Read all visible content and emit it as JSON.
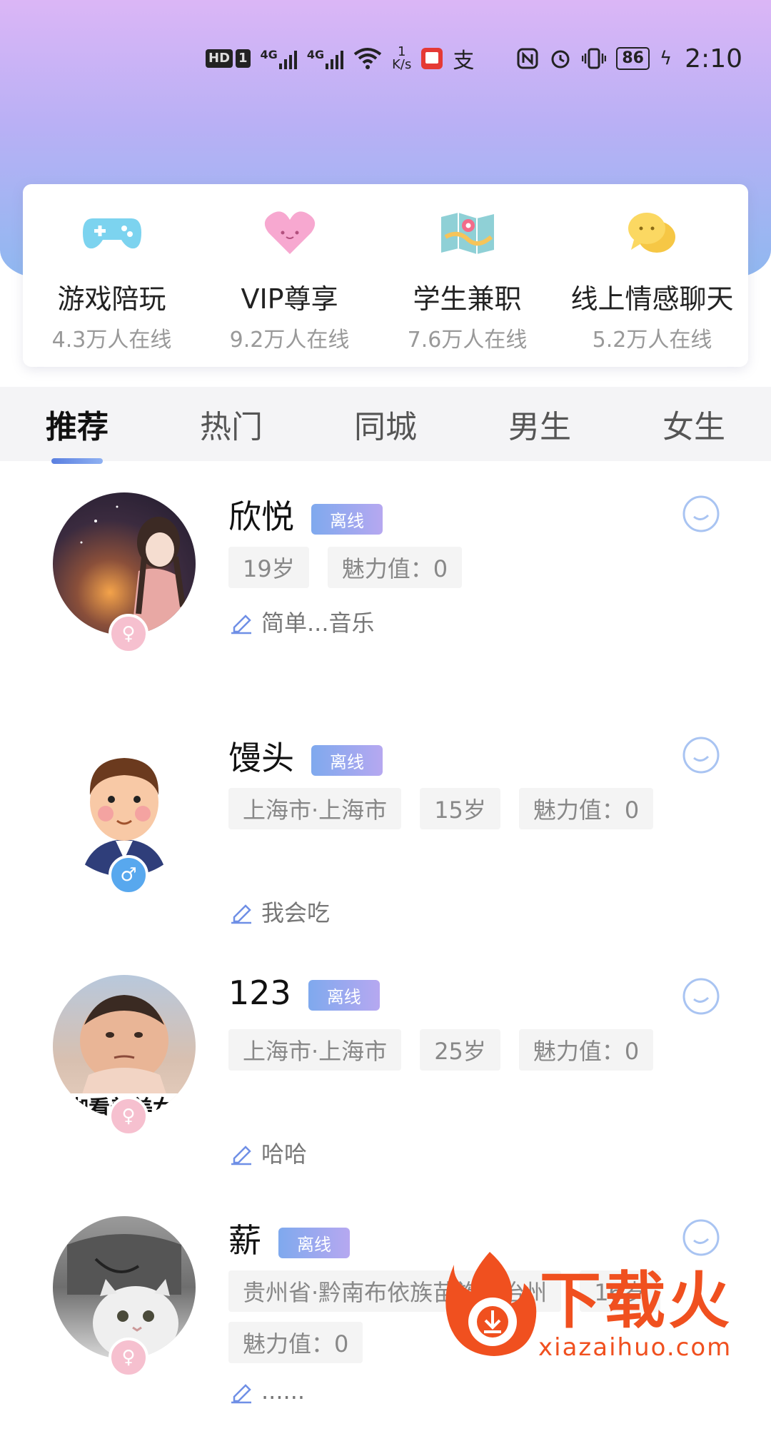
{
  "status_bar": {
    "hd": "HD",
    "sim": "1",
    "net1": "4G",
    "net2": "4G",
    "speed_value": "1",
    "speed_unit": "K/s",
    "alipay": "支",
    "battery": "86",
    "time": "2:10"
  },
  "categories": [
    {
      "title": "游戏陪玩",
      "online": "4.3万人在线",
      "icon": "gamepad-icon"
    },
    {
      "title": "VIP尊享",
      "online": "9.2万人在线",
      "icon": "heart-icon"
    },
    {
      "title": "学生兼职",
      "online": "7.6万人在线",
      "icon": "map-icon"
    },
    {
      "title": "线上情感聊天",
      "online": "5.2万人在线",
      "icon": "chat-bubbles-icon"
    }
  ],
  "tabs": [
    "推荐",
    "热门",
    "同城",
    "男生",
    "女生"
  ],
  "users": [
    {
      "name": "欣悦",
      "status": "离线",
      "tags": [
        "19岁",
        "魅力值：0"
      ],
      "signature": "简单...音乐",
      "gender": "female"
    },
    {
      "name": "馒头",
      "status": "离线",
      "tags": [
        "上海市·上海市",
        "15岁",
        "魅力值：0"
      ],
      "signature": "我会吃",
      "gender": "male"
    },
    {
      "name": "123",
      "status": "离线",
      "tags": [
        "上海市·上海市",
        "25岁",
        "魅力值：0"
      ],
      "signature": "哈哈",
      "gender": "female",
      "avatar_caption": "咖看着美女"
    },
    {
      "name": "薪",
      "status": "离线",
      "tags": [
        "贵州省·黔南布依族苗族自治州",
        "16岁",
        "魅力值：0"
      ],
      "signature": "......",
      "gender": "female"
    }
  ],
  "watermark": {
    "title": "下载火",
    "url": "xiazaihuo.com"
  },
  "colors": {
    "accent": "#6f8fe6",
    "hero_top": "#dbb6f6",
    "hero_bottom": "#8fb8f0",
    "watermark": "#f0501f"
  }
}
